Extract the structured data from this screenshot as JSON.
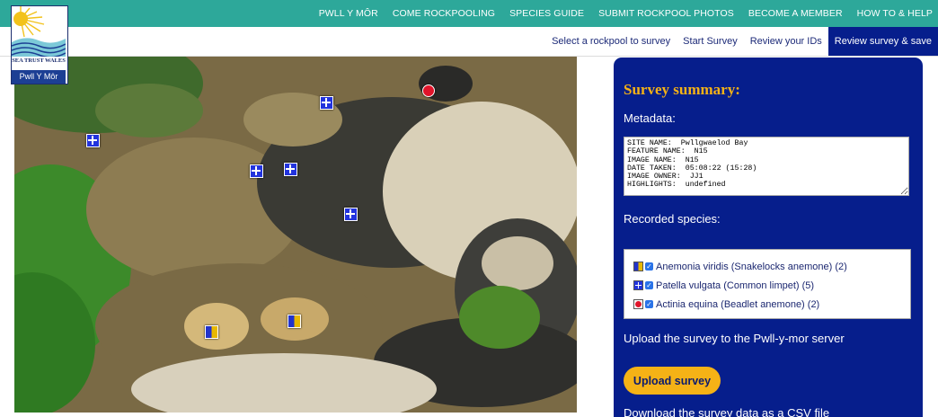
{
  "logo": {
    "org": "SEA TRUST WALES",
    "name": "Pwll Y Môr"
  },
  "topnav": [
    "PWLL Y MÔR",
    "COME ROCKPOOLING",
    "SPECIES GUIDE",
    "SUBMIT ROCKPOOL PHOTOS",
    "BECOME A MEMBER",
    "HOW TO & HELP"
  ],
  "subnav": [
    "Select a rockpool to survey",
    "Start Survey",
    "Review your IDs",
    "Review survey & save"
  ],
  "panel": {
    "title": "Survey summary:",
    "metadata_label": "Metadata:",
    "metadata_text": "SITE NAME:  Pwllgwaelod Bay\nFEATURE NAME:  N15\nIMAGE NAME:  N15\nDATE TAKEN:  05:08:22 (15:28)\nIMAGE OWNER:  JJ1\nHIGHLIGHTS:  undefined",
    "species_label": "Recorded species:",
    "species": [
      {
        "icon": "snakelocks-marker-icon",
        "label": "Anemonia viridis (Snakelocks anemone) (2)"
      },
      {
        "icon": "limpet-marker-icon",
        "label": "Patella vulgata (Common limpet) (5)"
      },
      {
        "icon": "beadlet-marker-icon",
        "label": "Actinia equina (Beadlet anemone) (2)"
      }
    ],
    "upload_text": "Upload the survey to the Pwll-y-mor server",
    "upload_button": "Upload survey",
    "download_text": "Download the survey data as a CSV file"
  },
  "colors": {
    "topbar": "#2da89a",
    "panel": "#061e8c",
    "accent": "#f5b216"
  }
}
